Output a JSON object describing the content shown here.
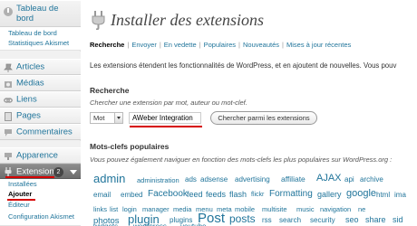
{
  "sidebar": {
    "dashboard": {
      "label": "Tableau de bord",
      "sub": [
        "Tableau de bord",
        "Statistiques Akismet"
      ]
    },
    "items": [
      {
        "label": "Articles",
        "icon": "pin-icon"
      },
      {
        "label": "Médias",
        "icon": "media-icon"
      },
      {
        "label": "Liens",
        "icon": "links-icon"
      },
      {
        "label": "Pages",
        "icon": "page-icon"
      },
      {
        "label": "Commentaires",
        "icon": "comments-icon"
      },
      {
        "label": "Apparence",
        "icon": "appearance-icon"
      }
    ],
    "extensions": {
      "label": "Extensions",
      "badge": "2",
      "sub": [
        "Installées",
        "Ajouter",
        "Éditeur",
        "Configuration Akismet"
      ]
    }
  },
  "page": {
    "title": "Installer des extensions",
    "tabs": [
      "Recherche",
      "Envoyer",
      "En vedette",
      "Populaires",
      "Nouveautés",
      "Mises à jour récentes"
    ],
    "intro": "Les extensions étendent les fonctionnalités de WordPress, et en ajoutent de nouvelles. Vous pouv",
    "search": {
      "heading": "Recherche",
      "help": "Chercher une extension par mot, auteur ou mot-clef.",
      "type_value": "Mot",
      "query_value": "AWeber Integration",
      "button_label": "Chercher parmi les extensions"
    },
    "tags_section": {
      "heading": "Mots-clefs populaires",
      "help": "Vous pouvez également naviguer en fonction des mots-clefs les plus populaires sur WordPress.org :"
    },
    "tags": [
      "admin",
      "administration",
      "ads",
      "adsense",
      "advertising",
      "affiliate",
      "AJAX",
      "api",
      "archive",
      "email",
      "embed",
      "Facebook",
      "feed",
      "feeds",
      "flash",
      "flickr",
      "Formatting",
      "gallery",
      "google",
      "html",
      "ima",
      "links",
      "list",
      "login",
      "manager",
      "media",
      "menu",
      "meta",
      "mobile",
      "multisite",
      "music",
      "navigation",
      "ne",
      "photos",
      "plugin",
      "plugins",
      "Post",
      "posts",
      "rss",
      "search",
      "security",
      "seo",
      "share",
      "sid",
      "widgets",
      "wordpress",
      "youtube"
    ],
    "colors": {
      "link": "#21759b",
      "highlight": "#d60000"
    }
  }
}
